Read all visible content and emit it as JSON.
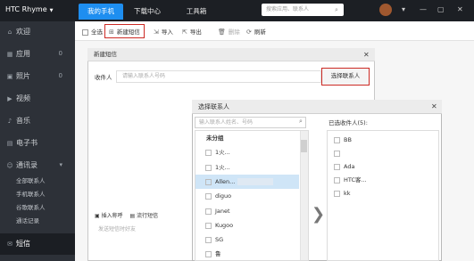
{
  "window": {
    "app_title": "HTC Rhyme",
    "tabs": [
      "我的手机",
      "下载中心",
      "工具箱"
    ],
    "search_placeholder": "搜索应用、联系人",
    "controls": [
      "▾",
      "—",
      "▢",
      "✕"
    ]
  },
  "sidebar": {
    "items": [
      {
        "label": "欢迎",
        "icon": "home-icon"
      },
      {
        "label": "应用",
        "icon": "apps-icon",
        "count": "0"
      },
      {
        "label": "照片",
        "icon": "photo-icon",
        "count": "0"
      },
      {
        "label": "视频",
        "icon": "video-icon"
      },
      {
        "label": "音乐",
        "icon": "music-icon"
      },
      {
        "label": "电子书",
        "icon": "book-icon"
      },
      {
        "label": "通讯录",
        "icon": "contacts-icon"
      }
    ],
    "sub_items": [
      "全部联系人",
      "手机联系人",
      "谷歌联系人",
      "通话记录"
    ],
    "active": "短信"
  },
  "toolbar": {
    "select_all": "全选",
    "new_sms": "新建短信",
    "import": "导入",
    "export": "导出",
    "delete": "删除",
    "refresh": "刷新"
  },
  "new_sms_dialog": {
    "title": "新建短信",
    "recipient_label": "收件人",
    "recipient_placeholder": "请输入联系人号码",
    "pick_button": "选择联系人",
    "insert_name": "插入称呼",
    "popular_sms": "流行短信",
    "body_placeholder": "发送短信时好友"
  },
  "pick_dialog": {
    "title": "选择联系人",
    "search_placeholder": "输入联系人姓名、号码",
    "group": "未分组",
    "contacts": [
      "1火...",
      "1火...",
      "Allen...",
      "diguo",
      "Janet",
      "Kugoo",
      "SG",
      "鲁"
    ],
    "selected_label": "已选收件人(5):",
    "selected": [
      "BB",
      "",
      "Ada",
      "HTC客...",
      "kk"
    ]
  }
}
